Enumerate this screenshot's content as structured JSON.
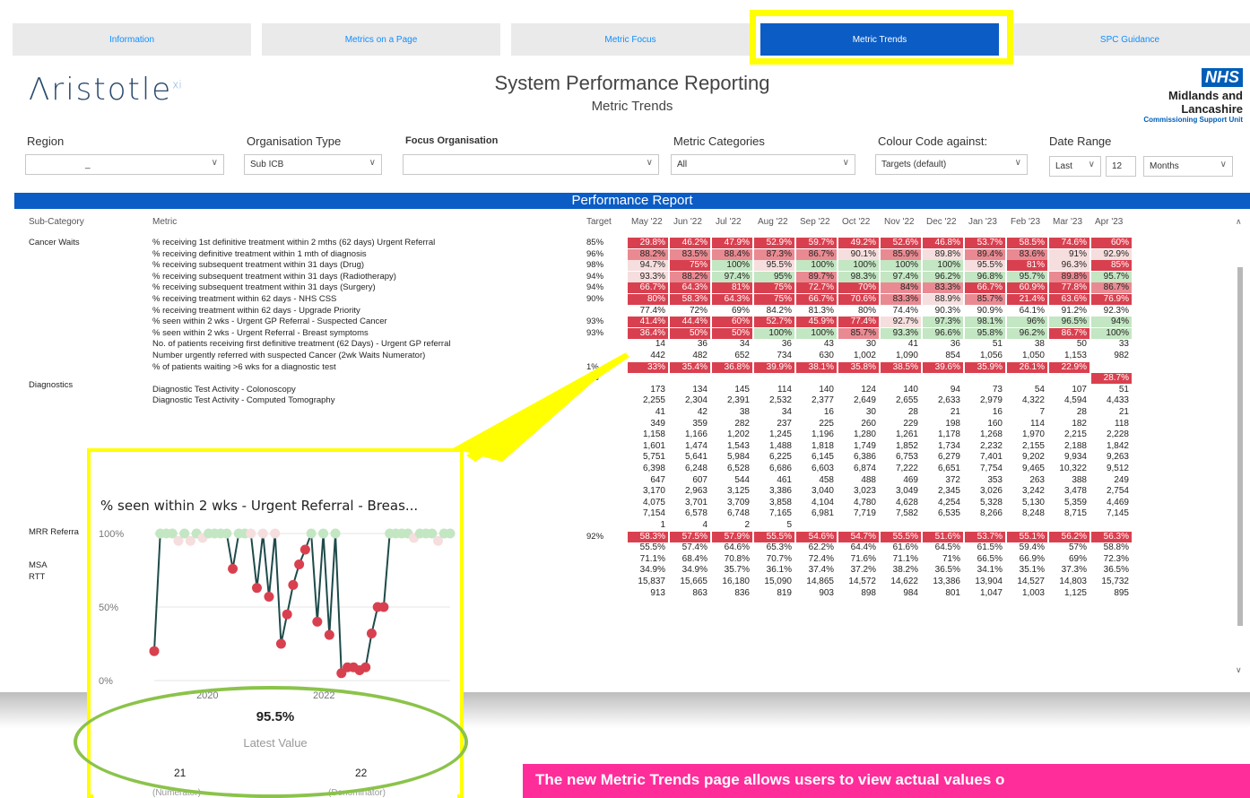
{
  "tabs": [
    "Information",
    "Metrics on a Page",
    "Metric Focus",
    "Metric Trends",
    "SPC Guidance"
  ],
  "logo": {
    "name": "Λristotle",
    "sup": "xi"
  },
  "header": {
    "title": "System Performance Reporting",
    "subtitle": "Metric Trends"
  },
  "nhs": {
    "mark": "NHS",
    "org": "Midlands and Lancashire",
    "unit": "Commissioning Support Unit"
  },
  "filters": {
    "region_label": "Region",
    "region_value": "_",
    "orgtype_label": "Organisation Type",
    "orgtype_value": "Sub ICB",
    "focus_label": "Focus Organisation",
    "focus_value": "",
    "metriccat_label": "Metric Categories",
    "metriccat_value": "All",
    "colour_label": "Colour Code against:",
    "colour_value": "Targets (default)",
    "date_label": "Date Range",
    "date_mode": "Last",
    "date_n": "12",
    "date_unit": "Months"
  },
  "report": {
    "title": "Performance Report",
    "col_subcat": "Sub-Category",
    "col_metric": "Metric",
    "col_target": "Target",
    "months": [
      "May '22",
      "Jun '22",
      "Jul '22",
      "Aug '22",
      "Sep '22",
      "Oct '22",
      "Nov '22",
      "Dec '22",
      "Jan '23",
      "Feb '23",
      "Mar '23",
      "Apr '23"
    ],
    "subcats": [
      {
        "label": "Cancer Waits",
        "row": 0
      },
      {
        "label": "Diagnostics",
        "row": 13
      },
      {
        "label": "MRR Referra",
        "row": 26
      },
      {
        "label": "MSA",
        "row": 29
      },
      {
        "label": "RTT",
        "row": 30
      }
    ],
    "rows": [
      {
        "metric": "% receiving 1st definitive treatment within 2 mths (62 days) Urgent Referral",
        "target": "85%",
        "values": [
          "29.8%",
          "46.2%",
          "47.9%",
          "52.9%",
          "59.7%",
          "49.2%",
          "52.6%",
          "46.8%",
          "53.7%",
          "58.5%",
          "74.6%",
          "60%"
        ],
        "colors": [
          "R",
          "R",
          "R",
          "R",
          "R",
          "R",
          "R",
          "R",
          "R",
          "R",
          "R",
          "R"
        ]
      },
      {
        "metric": "% receiving definitive treatment within 1 mth of diagnosis",
        "target": "96%",
        "values": [
          "88.2%",
          "83.5%",
          "88.4%",
          "87.3%",
          "86.7%",
          "90.1%",
          "85.9%",
          "89.8%",
          "89.4%",
          "83.6%",
          "91%",
          "92.9%"
        ],
        "colors": [
          "m",
          "m",
          "m",
          "m",
          "m",
          "p",
          "m",
          "p",
          "m",
          "m",
          "p",
          "p"
        ]
      },
      {
        "metric": "% receiving subsequent treatment within 31 days (Drug)",
        "target": "98%",
        "values": [
          "94.7%",
          "75%",
          "100%",
          "95.5%",
          "100%",
          "100%",
          "100%",
          "100%",
          "95.5%",
          "81%",
          "96.3%",
          "85%"
        ],
        "colors": [
          "p",
          "R",
          "g",
          "p",
          "g",
          "g",
          "g",
          "g",
          "p",
          "R",
          "p",
          "R"
        ]
      },
      {
        "metric": "% receiving subsequent treatment within 31 days (Radiotherapy)",
        "target": "94%",
        "values": [
          "93.3%",
          "88.2%",
          "97.4%",
          "95%",
          "89.7%",
          "98.3%",
          "97.4%",
          "96.2%",
          "96.8%",
          "95.7%",
          "89.8%",
          "95.7%"
        ],
        "colors": [
          "p",
          "m",
          "g",
          "g",
          "m",
          "g",
          "g",
          "g",
          "g",
          "g",
          "m",
          "g"
        ]
      },
      {
        "metric": "% receiving subsequent treatment within 31 days (Surgery)",
        "target": "94%",
        "values": [
          "66.7%",
          "64.3%",
          "81%",
          "75%",
          "72.7%",
          "70%",
          "84%",
          "83.3%",
          "66.7%",
          "60.9%",
          "77.8%",
          "86.7%"
        ],
        "colors": [
          "R",
          "R",
          "R",
          "R",
          "R",
          "R",
          "m",
          "m",
          "R",
          "R",
          "R",
          "m"
        ]
      },
      {
        "metric": "% receiving treatment within 62 days - NHS CSS",
        "target": "90%",
        "values": [
          "80%",
          "58.3%",
          "64.3%",
          "75%",
          "66.7%",
          "70.6%",
          "83.3%",
          "88.9%",
          "85.7%",
          "21.4%",
          "63.6%",
          "76.9%"
        ],
        "colors": [
          "R",
          "R",
          "R",
          "R",
          "R",
          "R",
          "m",
          "p",
          "m",
          "R",
          "R",
          "R"
        ]
      },
      {
        "metric": "% receiving treatment within 62 days - Upgrade Priority",
        "target": "",
        "values": [
          "77.4%",
          "72%",
          "69%",
          "84.2%",
          "81.3%",
          "80%",
          "74.4%",
          "90.3%",
          "90.9%",
          "64.1%",
          "91.2%",
          "92.3%"
        ],
        "colors": [
          "",
          "",
          "",
          "",
          "",
          "",
          "",
          "",
          "",
          "",
          "",
          ""
        ]
      },
      {
        "metric": "% seen within 2 wks - Urgent GP Referral - Suspected Cancer",
        "target": "93%",
        "values": [
          "41.4%",
          "44.4%",
          "60%",
          "52.7%",
          "45.9%",
          "77.4%",
          "92.7%",
          "97.3%",
          "98.1%",
          "96%",
          "96.5%",
          "94%"
        ],
        "colors": [
          "R",
          "R",
          "R",
          "R",
          "R",
          "R",
          "p",
          "g",
          "g",
          "g",
          "g",
          "g"
        ]
      },
      {
        "metric": "% seen within 2 wks - Urgent Referral - Breast symptoms",
        "target": "93%",
        "values": [
          "36.4%",
          "50%",
          "50%",
          "100%",
          "100%",
          "85.7%",
          "93.3%",
          "96.6%",
          "95.8%",
          "96.2%",
          "86.7%",
          "100%"
        ],
        "colors": [
          "R",
          "R",
          "R",
          "g",
          "g",
          "m",
          "g",
          "g",
          "g",
          "g",
          "R",
          "g"
        ]
      },
      {
        "metric": "No. of patients receiving first definitive treatment (62 Days) - Urgent GP referral",
        "target": "",
        "values": [
          "14",
          "36",
          "34",
          "36",
          "43",
          "30",
          "41",
          "36",
          "51",
          "38",
          "50",
          "33"
        ],
        "colors": [
          "",
          "",
          "",
          "",
          "",
          "",
          "",
          "",
          "",
          "",
          "",
          ""
        ]
      },
      {
        "metric": "Number urgently referred with suspected Cancer (2wk Waits Numerator)",
        "target": "",
        "values": [
          "442",
          "482",
          "652",
          "734",
          "630",
          "1,002",
          "1,090",
          "854",
          "1,056",
          "1,050",
          "1,153",
          "982"
        ],
        "colors": [
          "",
          "",
          "",
          "",
          "",
          "",
          "",
          "",
          "",
          "",
          "",
          ""
        ]
      },
      {
        "metric": "% of patients waiting >6 wks for a diagnostic test",
        "target": "1%",
        "values": [
          "33%",
          "35.4%",
          "36.8%",
          "39.9%",
          "38.1%",
          "35.8%",
          "38.5%",
          "39.6%",
          "35.9%",
          "26.1%",
          "22.9%",
          ""
        ],
        "colors": [
          "R",
          "R",
          "R",
          "R",
          "R",
          "R",
          "R",
          "R",
          "R",
          "R",
          "R",
          ""
        ]
      },
      {
        "metric": "",
        "target": "5%",
        "values": [
          "",
          "",
          "",
          "",
          "",
          "",
          "",
          "",
          "",
          "",
          "",
          "28.7%"
        ],
        "colors": [
          "",
          "",
          "",
          "",
          "",
          "",
          "",
          "",
          "",
          "",
          "",
          "R"
        ]
      },
      {
        "metric": "Diagnostic Test Activity - Colonoscopy",
        "target": "",
        "values": [
          "173",
          "134",
          "145",
          "114",
          "140",
          "124",
          "140",
          "94",
          "73",
          "54",
          "107",
          "51"
        ],
        "colors": []
      },
      {
        "metric": "Diagnostic Test Activity - Computed Tomography",
        "target": "",
        "values": [
          "2,255",
          "2,304",
          "2,391",
          "2,532",
          "2,377",
          "2,649",
          "2,655",
          "2,633",
          "2,979",
          "4,322",
          "4,594",
          "4,433"
        ],
        "colors": []
      },
      {
        "metric": "",
        "target": "",
        "values": [
          "41",
          "42",
          "38",
          "34",
          "16",
          "30",
          "28",
          "21",
          "16",
          "7",
          "28",
          "21"
        ],
        "colors": []
      },
      {
        "metric": "",
        "target": "",
        "values": [
          "349",
          "359",
          "282",
          "237",
          "225",
          "260",
          "229",
          "198",
          "160",
          "114",
          "182",
          "118"
        ],
        "colors": []
      },
      {
        "metric": "",
        "target": "",
        "values": [
          "1,158",
          "1,166",
          "1,202",
          "1,245",
          "1,196",
          "1,280",
          "1,261",
          "1,178",
          "1,268",
          "1,970",
          "2,215",
          "2,228"
        ],
        "colors": []
      },
      {
        "metric": "",
        "target": "",
        "values": [
          "1,601",
          "1,474",
          "1,543",
          "1,488",
          "1,818",
          "1,749",
          "1,852",
          "1,734",
          "2,232",
          "2,155",
          "2,188",
          "1,842"
        ],
        "colors": []
      },
      {
        "metric": "",
        "target": "",
        "values": [
          "5,751",
          "5,641",
          "5,984",
          "6,225",
          "6,145",
          "6,386",
          "6,753",
          "6,279",
          "7,401",
          "9,202",
          "9,934",
          "9,263"
        ],
        "colors": []
      },
      {
        "metric": "",
        "target": "",
        "values": [
          "6,398",
          "6,248",
          "6,528",
          "6,686",
          "6,603",
          "6,874",
          "7,222",
          "6,651",
          "7,754",
          "9,465",
          "10,322",
          "9,512"
        ],
        "colors": []
      },
      {
        "metric": "",
        "target": "",
        "values": [
          "647",
          "607",
          "544",
          "461",
          "458",
          "488",
          "469",
          "372",
          "353",
          "263",
          "388",
          "249"
        ],
        "colors": []
      },
      {
        "metric": "",
        "target": "",
        "values": [
          "3,170",
          "2,963",
          "3,125",
          "3,386",
          "3,040",
          "3,023",
          "3,049",
          "2,345",
          "3,026",
          "3,242",
          "3,478",
          "2,754"
        ],
        "colors": []
      },
      {
        "metric": "",
        "target": "",
        "values": [
          "4,075",
          "3,701",
          "3,709",
          "3,858",
          "4,104",
          "4,780",
          "4,628",
          "4,254",
          "5,328",
          "5,130",
          "5,359",
          "4,469"
        ],
        "colors": []
      },
      {
        "metric": "",
        "target": "",
        "values": [
          "7,154",
          "6,578",
          "6,748",
          "7,165",
          "6,981",
          "7,719",
          "7,582",
          "6,535",
          "8,266",
          "8,248",
          "8,715",
          "7,145"
        ],
        "colors": []
      },
      {
        "metric": "",
        "target": "",
        "values": [
          "1",
          "4",
          "2",
          "5",
          "",
          "",
          "",
          "",
          "",
          "",
          "",
          ""
        ],
        "colors": []
      },
      {
        "metric": "",
        "target": "92%",
        "values": [
          "58.3%",
          "57.5%",
          "57.9%",
          "55.5%",
          "54.6%",
          "54.7%",
          "55.5%",
          "51.6%",
          "53.7%",
          "55.1%",
          "56.2%",
          "56.3%"
        ],
        "colors": [
          "R",
          "R",
          "R",
          "R",
          "R",
          "R",
          "R",
          "R",
          "R",
          "R",
          "R",
          "R"
        ]
      },
      {
        "metric": "",
        "target": "",
        "values": [
          "55.5%",
          "57.4%",
          "64.6%",
          "65.3%",
          "62.2%",
          "64.4%",
          "61.6%",
          "64.5%",
          "61.5%",
          "59.4%",
          "57%",
          "58.8%"
        ],
        "colors": []
      },
      {
        "metric": "",
        "target": "",
        "values": [
          "71.1%",
          "68.4%",
          "70.8%",
          "70.7%",
          "72.4%",
          "71.6%",
          "71.1%",
          "71%",
          "66.5%",
          "66.9%",
          "69%",
          "72.3%"
        ],
        "colors": []
      },
      {
        "metric": "",
        "target": "",
        "values": [
          "34.9%",
          "34.9%",
          "35.7%",
          "36.1%",
          "37.4%",
          "37.2%",
          "38.2%",
          "36.5%",
          "34.1%",
          "35.1%",
          "37.3%",
          "36.5%"
        ],
        "colors": []
      },
      {
        "metric": "",
        "target": "",
        "values": [
          "15,837",
          "15,665",
          "16,180",
          "15,090",
          "14,865",
          "14,572",
          "14,622",
          "13,386",
          "13,904",
          "14,527",
          "14,803",
          "15,732"
        ],
        "colors": []
      },
      {
        "metric": "",
        "target": "",
        "values": [
          "913",
          "863",
          "836",
          "819",
          "903",
          "898",
          "984",
          "801",
          "1,047",
          "1,003",
          "1,125",
          "895"
        ],
        "colors": []
      }
    ]
  },
  "popup": {
    "title": "% seen within 2 wks - Urgent Referral - Breas...",
    "y_ticks": [
      "100%",
      "50%",
      "0%"
    ],
    "x_ticks": [
      "2020",
      "2022"
    ],
    "latest_value": "95.5%",
    "latest_label": "Latest Value",
    "numerator": "21",
    "numerator_label": "(Numerator)",
    "denominator": "22",
    "denominator_label": "(Denominator)"
  },
  "chart_data": {
    "type": "line",
    "title": "% seen within 2 wks - Urgent Referral - Breas...",
    "ylim": [
      0,
      100
    ],
    "yticks": [
      "0%",
      "50%",
      "100%"
    ],
    "xticks": [
      "2020",
      "2022"
    ],
    "series": [
      {
        "values": [
          20,
          100,
          100,
          100,
          95,
          100,
          95,
          100,
          97,
          100,
          100,
          100,
          100,
          76,
          100,
          100,
          100,
          63,
          100,
          57,
          100,
          25,
          45,
          65,
          79,
          89,
          100,
          40,
          100,
          31,
          100,
          5,
          9,
          9,
          7,
          9,
          32,
          50,
          50,
          100,
          100,
          100,
          100,
          97,
          100,
          100,
          100,
          95,
          100,
          100
        ]
      }
    ],
    "point_colors": [
      "R",
      "g",
      "g",
      "g",
      "p",
      "g",
      "p",
      "g",
      "p",
      "g",
      "g",
      "g",
      "g",
      "R",
      "g",
      "g",
      "p",
      "R",
      "p",
      "R",
      "p",
      "R",
      "R",
      "R",
      "R",
      "R",
      "g",
      "R",
      "g",
      "R",
      "g",
      "R",
      "R",
      "R",
      "R",
      "R",
      "R",
      "R",
      "R",
      "g",
      "g",
      "g",
      "g",
      "p",
      "g",
      "g",
      "g",
      "p",
      "g",
      "g"
    ]
  },
  "colors": {
    "R": "#d9404f",
    "m": "#e98a92",
    "p": "#f6dede",
    "g": "#c3e6c3",
    "tab_active": "#0b5cc5",
    "highlight": "#ffff00",
    "oval": "#8bc34a",
    "callout": "#ff2d9a"
  },
  "callout": "The new Metric Trends page allows users to view actual values o"
}
